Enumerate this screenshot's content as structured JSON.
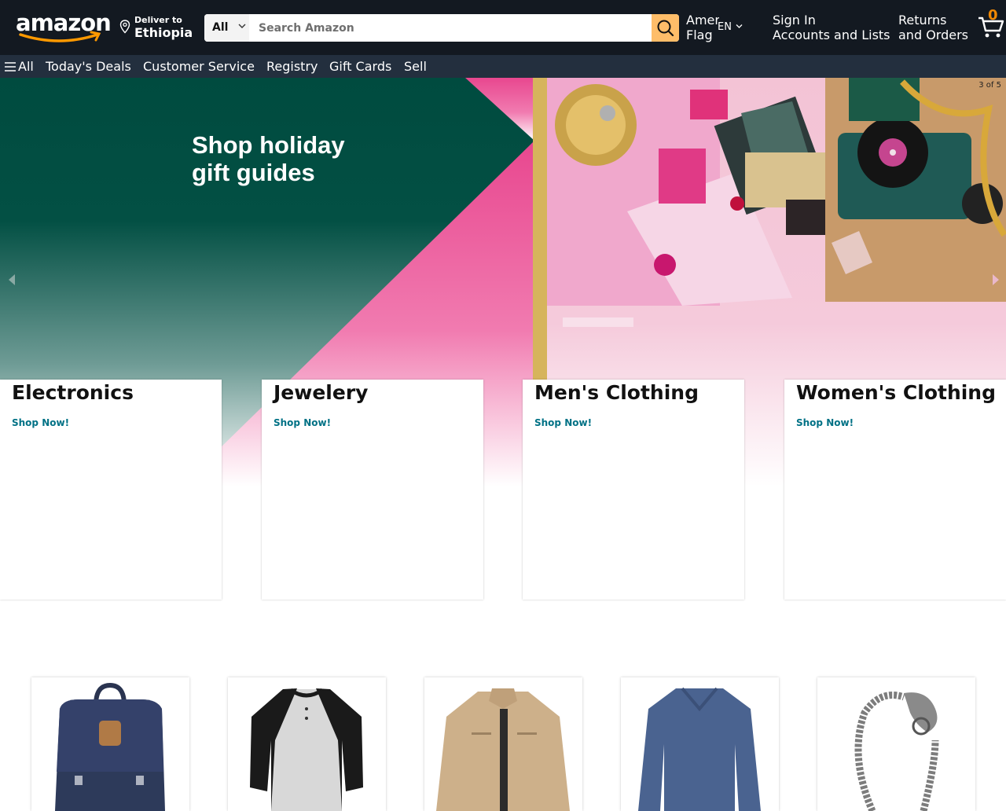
{
  "header": {
    "logo_text": "amazon",
    "deliver_to_label": "Deliver to",
    "deliver_to_location": "Ethiopia",
    "search": {
      "category": "All",
      "placeholder": "Search Amazon"
    },
    "language": {
      "flag_alt": "American Flag",
      "code": "EN"
    },
    "account": {
      "line1": "Sign In",
      "line2": "Accounts and Lists"
    },
    "returns": {
      "line1": "Returns",
      "line2": "and Orders"
    },
    "cart_count": "0"
  },
  "subnav": {
    "all_label": "All",
    "items": [
      "Today's Deals",
      "Customer Service",
      "Registry",
      "Gift Cards",
      "Sell"
    ]
  },
  "hero": {
    "title_line1": "Shop holiday",
    "title_line2": "gift guides",
    "slide_counter": "3 of 5"
  },
  "categories": [
    {
      "title": "Electronics",
      "link": "Shop Now!"
    },
    {
      "title": "Jewelery",
      "link": "Shop Now!"
    },
    {
      "title": "Men's Clothing",
      "link": "Shop Now!"
    },
    {
      "title": "Women's Clothing",
      "link": "Shop Now!"
    }
  ],
  "products": [
    {
      "icon": "backpack-image"
    },
    {
      "icon": "raglan-shirt-image"
    },
    {
      "icon": "jacket-image"
    },
    {
      "icon": "long-sleeve-shirt-image"
    },
    {
      "icon": "bracelet-image"
    }
  ],
  "colors": {
    "header_bg": "#131921",
    "subnav_bg": "#232f3e",
    "search_button": "#febd69",
    "link": "#007185",
    "cart_count": "#f08804"
  }
}
